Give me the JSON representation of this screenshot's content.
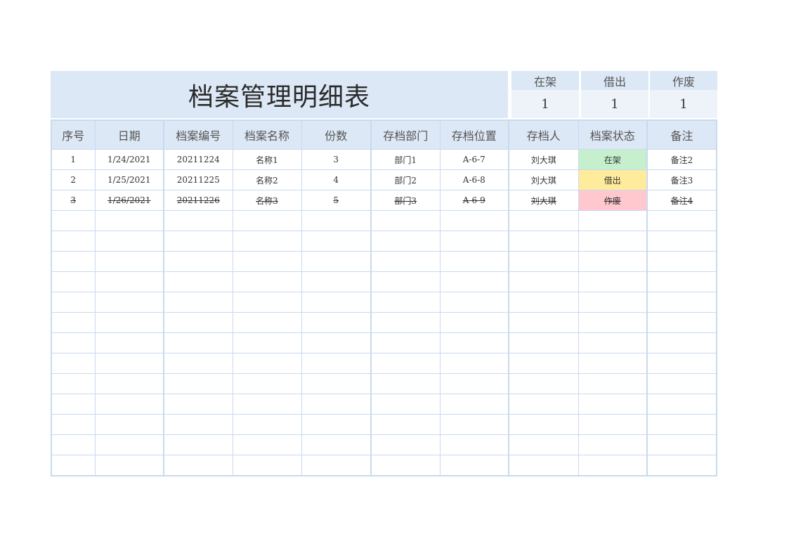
{
  "title": "档案管理明细表",
  "stats": [
    {
      "label": "在架",
      "value": "1"
    },
    {
      "label": "借出",
      "value": "1"
    },
    {
      "label": "作废",
      "value": "1"
    }
  ],
  "columns": [
    "序号",
    "日期",
    "档案编号",
    "档案名称",
    "份数",
    "存档部门",
    "存档位置",
    "存档人",
    "档案状态",
    "备注"
  ],
  "rows": [
    {
      "seq": "1",
      "date": "1/24/2021",
      "code": "20211224",
      "name": "名称1",
      "copies": "3",
      "dept": "部门1",
      "location": "A-6-7",
      "keeper": "刘大琪",
      "status": "在架",
      "note": "备注2"
    },
    {
      "seq": "2",
      "date": "1/25/2021",
      "code": "20211225",
      "name": "名称2",
      "copies": "4",
      "dept": "部门2",
      "location": "A-6-8",
      "keeper": "刘大琪",
      "status": "借出",
      "note": "备注3"
    },
    {
      "seq": "3",
      "date": "1/26/2021",
      "code": "20211226",
      "name": "名称3",
      "copies": "5",
      "dept": "部门3",
      "location": "A-6-9",
      "keeper": "刘大琪",
      "status": "作废",
      "note": "备注4"
    }
  ],
  "colors": {
    "header_bg": "#dce8f5",
    "grid_line": "#c8daf0",
    "status_on_shelf": "#c6efce",
    "status_lent": "#ffeb9c",
    "status_void": "#ffc7ce"
  }
}
